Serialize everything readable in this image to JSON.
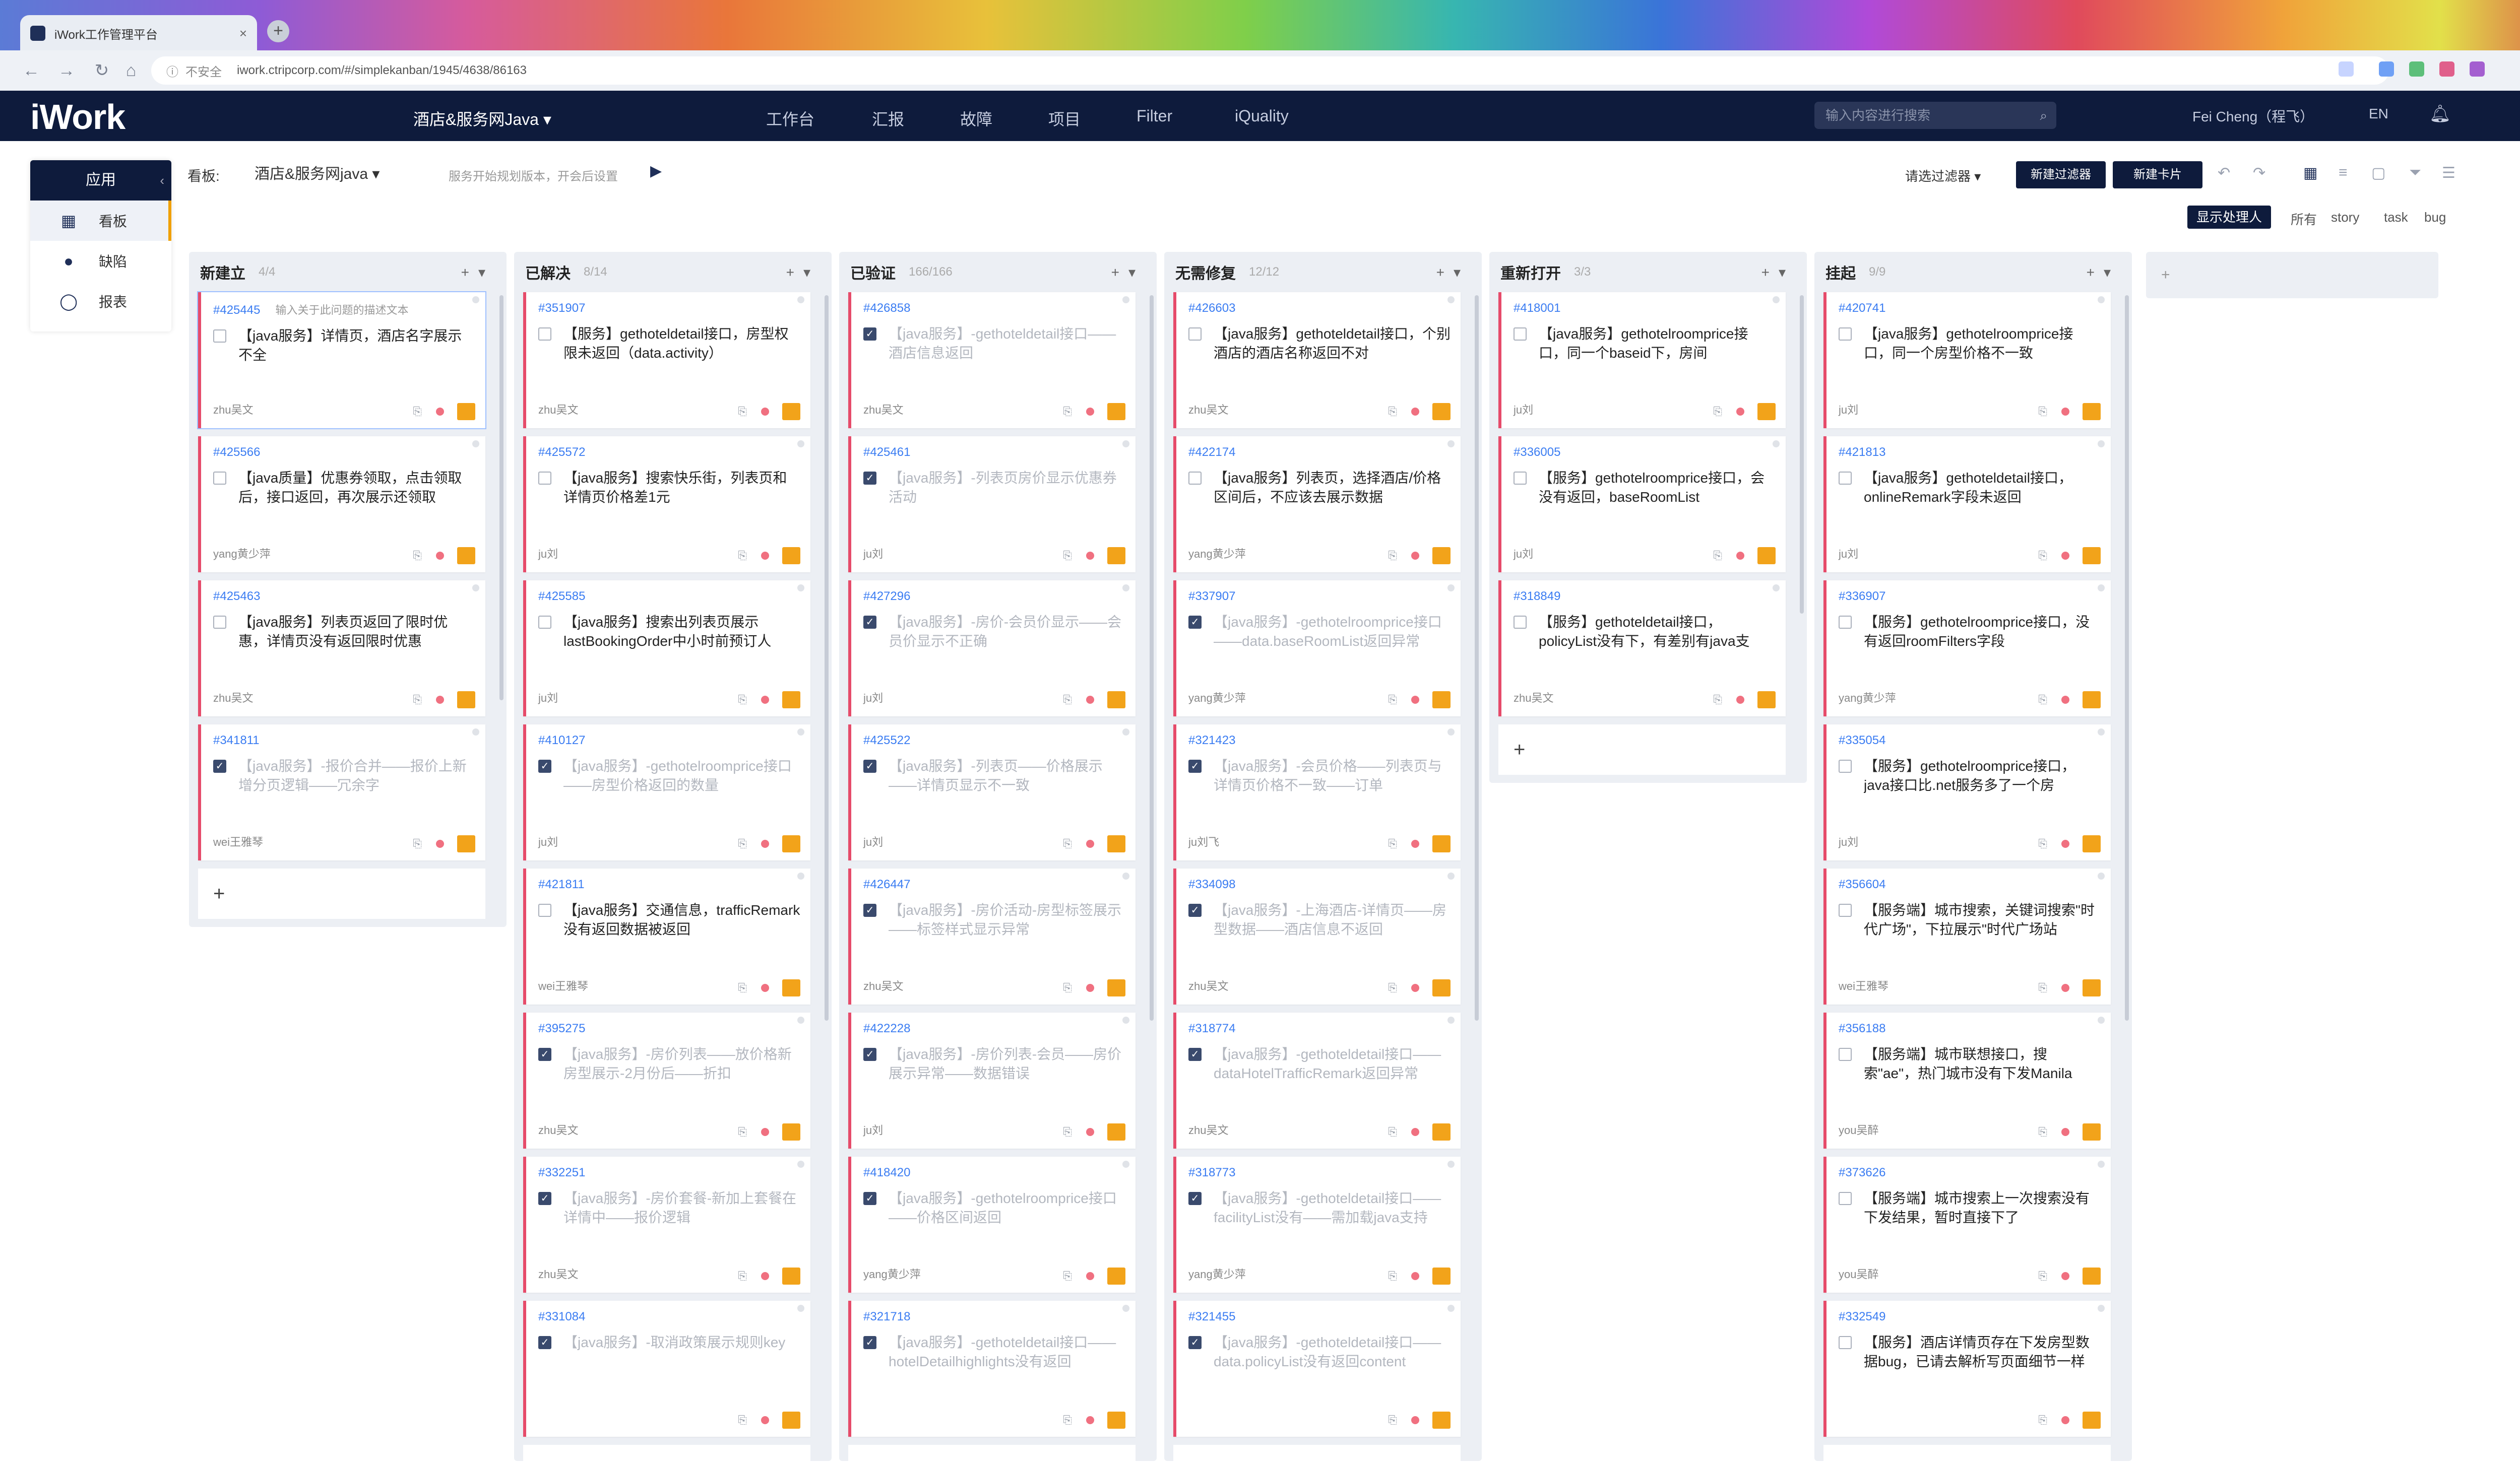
{
  "browser": {
    "tab_title": "iWork工作管理平台",
    "tab_close": "×",
    "new_tab": "+",
    "security_label": "不安全",
    "url": "iwork.ctripcorp.com/#/simplekanban/1945/4638/86163"
  },
  "app": {
    "logo": "iWork",
    "board_select": "酒店&服务网Java ▾",
    "nav": [
      "工作台",
      "汇报",
      "故障",
      "项目",
      "Filter",
      "iQuality"
    ],
    "search_placeholder": "输入内容进行搜索",
    "user": "Fei Cheng（程飞）",
    "lang": "EN",
    "bell_icon": "bell-icon"
  },
  "sidebar": {
    "header": "应用",
    "items": [
      {
        "label": "看板",
        "icon": "board-icon"
      },
      {
        "label": "缺陷",
        "icon": "bug-icon"
      },
      {
        "label": "报表",
        "icon": "report-icon"
      }
    ]
  },
  "toolbar": {
    "board_label": "看板:",
    "board_name": "酒店&服务网java ▾",
    "board_desc": "服务开始规划版本，开会后设置",
    "filter": "请选过滤器 ▾",
    "btn_create_filter": "新建过滤器",
    "btn_create_card": "新建卡片",
    "btn_assignee": "显示处理人",
    "type_tabs": [
      "所有",
      "story",
      "task",
      "bug"
    ]
  },
  "columns": [
    {
      "title": "新建立",
      "count": "4/4",
      "cards": [
        {
          "id": "#425445",
          "subtitle": "输入关于此问题的描述文本",
          "text": "【java服务】详情页，酒店名字展示不全",
          "owner": "zhu吴文",
          "done": false,
          "highlight": true
        },
        {
          "id": "#425566",
          "text": "【java质量】优惠券领取，点击领取后，接口返回，再次展示还领取",
          "owner": "yang黄少萍",
          "done": false
        },
        {
          "id": "#425463",
          "text": "【java服务】列表页返回了限时优惠，详情页没有返回限时优惠",
          "owner": "zhu吴文",
          "done": false
        },
        {
          "id": "#341811",
          "text": "【java服务】-报价合并——报价上新增分页逻辑——冗余字",
          "owner": "wei王雅琴",
          "done": true
        }
      ]
    },
    {
      "title": "已解决",
      "count": "8/14",
      "cards": [
        {
          "id": "#351907",
          "text": "【服务】gethoteldetail接口，房型权限未返回（data.activity）",
          "owner": "zhu吴文",
          "done": false
        },
        {
          "id": "#425572",
          "text": "【java服务】搜索快乐街，列表页和详情页价格差1元",
          "owner": "ju刘",
          "done": false
        },
        {
          "id": "#425585",
          "text": "【java服务】搜索出列表页展示lastBookingOrder中小时前预订人",
          "owner": "ju刘",
          "done": false
        },
        {
          "id": "#410127",
          "text": "【java服务】-gethotelroomprice接口——房型价格返回的数量",
          "owner": "ju刘",
          "done": true
        },
        {
          "id": "#421811",
          "text": "【java服务】交通信息，trafficRemark没有返回数据被返回",
          "owner": "wei王雅琴",
          "done": false
        },
        {
          "id": "#395275",
          "text": "【java服务】-房价列表——放价格新房型展示-2月份后——折扣",
          "owner": "zhu吴文",
          "done": true
        },
        {
          "id": "#332251",
          "text": "【java服务】-房价套餐-新加上套餐在详情中——报价逻辑",
          "owner": "zhu吴文",
          "done": true
        },
        {
          "id": "#331084",
          "text": "【java服务】-取消政策展示规则key",
          "owner": "",
          "done": true
        }
      ]
    },
    {
      "title": "已验证",
      "count": "166/166",
      "cards": [
        {
          "id": "#426858",
          "text": "【java服务】-gethoteldetail接口——酒店信息返回",
          "owner": "zhu吴文",
          "done": true
        },
        {
          "id": "#425461",
          "text": "【java服务】-列表页房价显示优惠券活动",
          "owner": "ju刘",
          "done": true
        },
        {
          "id": "#427296",
          "text": "【java服务】-房价-会员价显示——会员价显示不正确",
          "owner": "ju刘",
          "done": true
        },
        {
          "id": "#425522",
          "text": "【java服务】-列表页——价格展示——详情页显示不一致",
          "owner": "ju刘",
          "done": true
        },
        {
          "id": "#426447",
          "text": "【java服务】-房价活动-房型标签展示——标签样式显示异常",
          "owner": "zhu吴文",
          "done": true
        },
        {
          "id": "#422228",
          "text": "【java服务】-房价列表-会员——房价展示异常——数据错误",
          "owner": "ju刘",
          "done": true
        },
        {
          "id": "#418420",
          "text": "【java服务】-gethotelroomprice接口——价格区间返回",
          "owner": "yang黄少萍",
          "done": true
        },
        {
          "id": "#321718",
          "text": "【java服务】-gethoteldetail接口——hotelDetailhighlights没有返回",
          "owner": "",
          "done": true
        }
      ]
    },
    {
      "title": "无需修复",
      "count": "12/12",
      "cards": [
        {
          "id": "#426603",
          "text": "【java服务】gethoteldetail接口，个别酒店的酒店名称返回不对",
          "owner": "zhu吴文",
          "done": false
        },
        {
          "id": "#422174",
          "text": "【java服务】列表页，选择酒店/价格区间后，不应该去展示数据",
          "owner": "yang黄少萍",
          "done": false
        },
        {
          "id": "#337907",
          "text": "【java服务】-gethotelroomprice接口——data.baseRoomList返回异常",
          "owner": "yang黄少萍",
          "done": true
        },
        {
          "id": "#321423",
          "text": "【java服务】-会员价格——列表页与详情页价格不一致——订单",
          "owner": "ju刘飞",
          "done": true
        },
        {
          "id": "#334098",
          "text": "【java服务】-上海酒店-详情页——房型数据——酒店信息不返回",
          "owner": "zhu吴文",
          "done": true
        },
        {
          "id": "#318774",
          "text": "【java服务】-gethoteldetail接口——dataHotelTrafficRemark返回异常",
          "owner": "zhu吴文",
          "done": true
        },
        {
          "id": "#318773",
          "text": "【java服务】-gethoteldetail接口——facilityList没有——需加载java支持",
          "owner": "yang黄少萍",
          "done": true
        },
        {
          "id": "#321455",
          "text": "【java服务】-gethoteldetail接口——data.policyList没有返回content",
          "owner": "",
          "done": true
        }
      ]
    },
    {
      "title": "重新打开",
      "count": "3/3",
      "cards": [
        {
          "id": "#418001",
          "text": "【java服务】gethotelroomprice接口，同一个baseid下，房间",
          "owner": "ju刘",
          "done": false
        },
        {
          "id": "#336005",
          "text": "【服务】gethotelroomprice接口，会没有返回，baseRoomList",
          "owner": "ju刘",
          "done": false
        },
        {
          "id": "#318849",
          "text": "【服务】gethoteldetail接口，policyList没有下，有差别有java支",
          "owner": "zhu吴文",
          "done": false
        }
      ]
    },
    {
      "title": "挂起",
      "count": "9/9",
      "cards": [
        {
          "id": "#420741",
          "text": "【java服务】gethotelroomprice接口，同一个房型价格不一致",
          "owner": "ju刘",
          "done": false
        },
        {
          "id": "#421813",
          "text": "【java服务】gethoteldetail接口，onlineRemark字段未返回",
          "owner": "ju刘",
          "done": false
        },
        {
          "id": "#336907",
          "text": "【服务】gethotelroomprice接口，没有返回roomFilters字段",
          "owner": "yang黄少萍",
          "done": false
        },
        {
          "id": "#335054",
          "text": "【服务】gethotelroomprice接口，java接口比.net服务多了一个房",
          "owner": "ju刘",
          "done": false
        },
        {
          "id": "#356604",
          "text": "【服务端】城市搜索，关键词搜索\"时代广场\"，下拉展示\"时代广场站",
          "owner": "wei王雅琴",
          "done": false
        },
        {
          "id": "#356188",
          "text": "【服务端】城市联想接口，搜索\"ae\"，热门城市没有下发Manila",
          "owner": "you吴醉",
          "done": false
        },
        {
          "id": "#373626",
          "text": "【服务端】城市搜索上一次搜索没有下发结果，暂时直接下了",
          "owner": "you吴醉",
          "done": false
        },
        {
          "id": "#332549",
          "text": "【服务】酒店详情页存在下发房型数据bug，已请去解析写页面细节一样",
          "owner": "",
          "done": false
        }
      ]
    }
  ],
  "add_label": "+",
  "new_column_label": "+"
}
